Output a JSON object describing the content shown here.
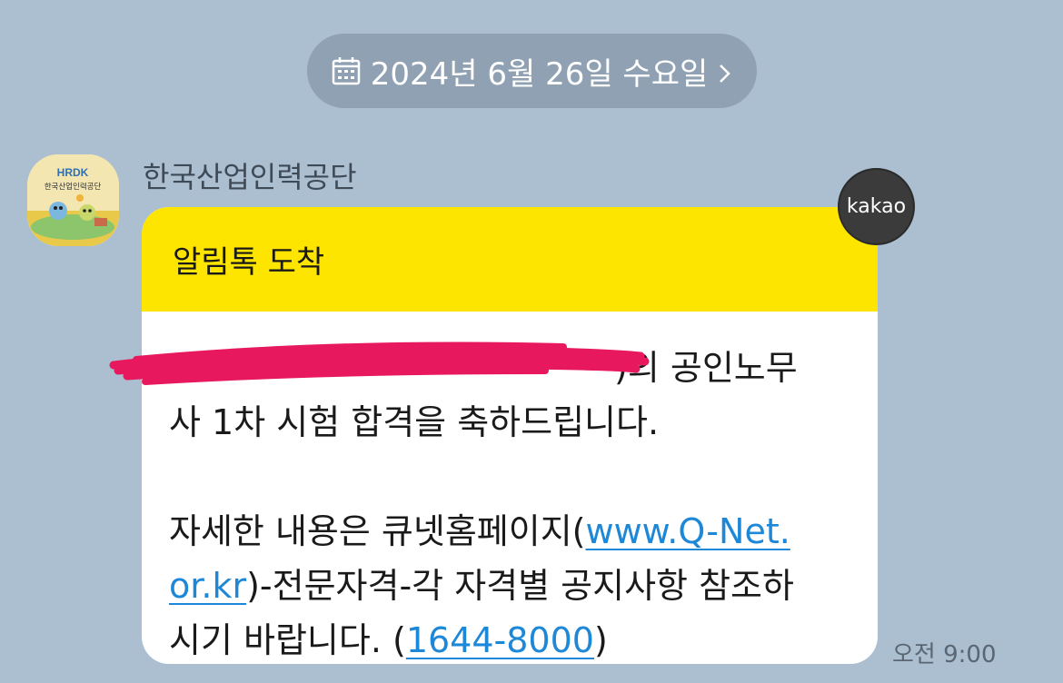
{
  "date_divider": {
    "icon": "calendar-icon",
    "label": "2024년 6월 26일 수요일",
    "chevron": "chevron-right-icon"
  },
  "sender": {
    "name": "한국산업인력공단",
    "avatar_text_top": "HRDK",
    "avatar_text_bottom": "한국산업인력공단"
  },
  "message": {
    "header": "알림톡 도착",
    "line1_tail": ")의 공인노무",
    "line2": "사 1차 시험 합격을 축하드립니다.",
    "line3_prefix": "자세한 내용은 큐넷홈페이지(",
    "link_site_part1": "www.Q-Net.",
    "link_site_part2": "or.kr",
    "line4_tail": ")-전문자격-각 자격별 공지사항 참조하",
    "line5_prefix": "시기 바랍니다. (",
    "link_phone": "1644-8000",
    "line5_suffix": ")",
    "badge": "kakao",
    "time": "오전 9:00"
  },
  "colors": {
    "background": "#abbfd1",
    "header_yellow": "#fee500",
    "link_blue": "#1e88d8",
    "redaction_pink": "#e8185f"
  }
}
